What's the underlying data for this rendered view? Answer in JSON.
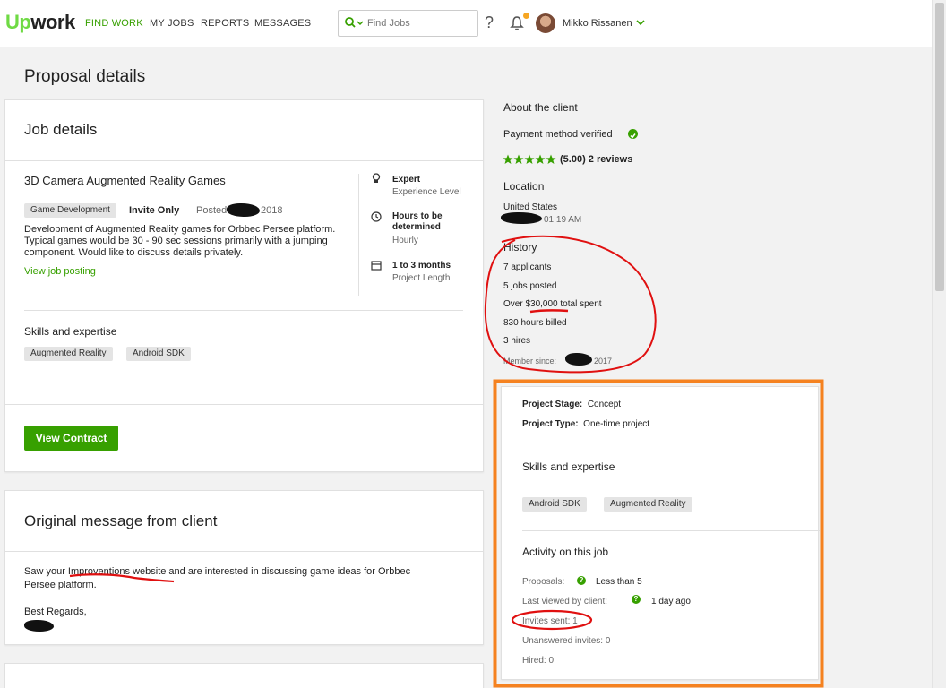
{
  "header": {
    "logo_up": "Up",
    "logo_work": "work",
    "nav": [
      "FIND WORK",
      "MY JOBS",
      "REPORTS",
      "MESSAGES"
    ],
    "search_placeholder": "Find Jobs",
    "help": "?",
    "user_name": "Mikko Rissanen"
  },
  "page_title": "Proposal details",
  "job": {
    "heading": "Job details",
    "title": "3D Camera Augmented Reality Games",
    "category": "Game Development",
    "invite": "Invite Only",
    "posted_label": "Posted",
    "posted_year": "2018",
    "description": "Development of Augmented Reality games for Orbbec Persee platform. Typical games would be 30 - 90 sec sessions primarily with a jumping component. Would like to discuss details privately.",
    "view_posting": "View job posting",
    "level": "Expert",
    "level_sub": "Experience Level",
    "hours": "Hours to be determined",
    "hours_sub": "Hourly",
    "length": "1 to 3 months",
    "length_sub": "Project Length",
    "skills_heading": "Skills and expertise",
    "skills": [
      "Augmented Reality",
      "Android SDK"
    ],
    "view_contract": "View Contract"
  },
  "message": {
    "heading": "Original message from client",
    "line1_a": "Saw your ",
    "line1_b": "Improventions",
    "line1_c": " website and are interested in discussing game ideas for Orbbec",
    "line2": "Persee platform.",
    "regards": "Best Regards,"
  },
  "client": {
    "heading": "About the client",
    "payment": "Payment method verified",
    "rating": "(5.00) 2 reviews",
    "location_heading": "Location",
    "country": "United States",
    "time": "01:19 AM",
    "history_heading": "History",
    "applicants": "7 applicants",
    "jobs_posted": "5 jobs posted",
    "spent_prefix": "Over ",
    "spent_amount": "$30,000",
    "spent_suffix": " total spent",
    "hours_billed": "830 hours billed",
    "hires": "3 hires",
    "member_since_label": "Member since:",
    "member_since_year": "2017"
  },
  "project": {
    "stage_label": "Project Stage:",
    "stage": "Concept",
    "type_label": "Project Type:",
    "type": "One-time project",
    "skills_heading": "Skills and expertise",
    "skills": [
      "Android SDK",
      "Augmented Reality"
    ],
    "activity_heading": "Activity on this job",
    "proposals_label": "Proposals:",
    "proposals": "Less than 5",
    "last_viewed_label": "Last viewed by client:",
    "last_viewed": "1 day ago",
    "invites_sent": "Invites sent: 1",
    "unanswered": "Unanswered invites: 0",
    "hired": "Hired: 0"
  },
  "colors": {
    "brand_green": "#37a000",
    "logo_green": "#6fda44",
    "annotation_red": "#e01010",
    "annotation_orange": "#f58220"
  },
  "rating_stars": 5
}
